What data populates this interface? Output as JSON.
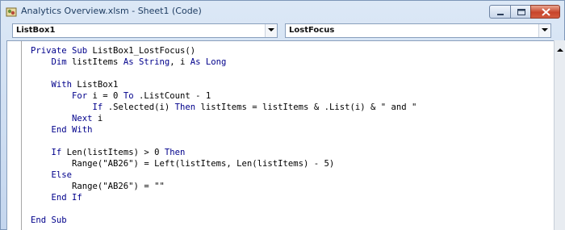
{
  "window": {
    "title": "Analytics Overview.xlsm - Sheet1 (Code)"
  },
  "toolbar": {
    "object_dropdown": {
      "selected": "ListBox1"
    },
    "procedure_dropdown": {
      "selected": "LostFocus"
    }
  },
  "code": {
    "lines": [
      [
        {
          "t": "Private Sub ",
          "k": true
        },
        {
          "t": "ListBox1_LostFocus()"
        }
      ],
      [
        {
          "t": "    "
        },
        {
          "t": "Dim ",
          "k": true
        },
        {
          "t": "listItems "
        },
        {
          "t": "As String",
          "k": true
        },
        {
          "t": ", i "
        },
        {
          "t": "As Long",
          "k": true
        }
      ],
      [
        {
          "t": ""
        }
      ],
      [
        {
          "t": "    "
        },
        {
          "t": "With ",
          "k": true
        },
        {
          "t": "ListBox1"
        }
      ],
      [
        {
          "t": "        "
        },
        {
          "t": "For ",
          "k": true
        },
        {
          "t": "i = 0 "
        },
        {
          "t": "To ",
          "k": true
        },
        {
          "t": ".ListCount - 1"
        }
      ],
      [
        {
          "t": "            "
        },
        {
          "t": "If ",
          "k": true
        },
        {
          "t": ".Selected(i) "
        },
        {
          "t": "Then ",
          "k": true
        },
        {
          "t": "listItems = listItems & .List(i) & \" and \""
        }
      ],
      [
        {
          "t": "        "
        },
        {
          "t": "Next ",
          "k": true
        },
        {
          "t": "i"
        }
      ],
      [
        {
          "t": "    "
        },
        {
          "t": "End With",
          "k": true
        }
      ],
      [
        {
          "t": ""
        }
      ],
      [
        {
          "t": "    "
        },
        {
          "t": "If ",
          "k": true
        },
        {
          "t": "Len(listItems) > 0 "
        },
        {
          "t": "Then",
          "k": true
        }
      ],
      [
        {
          "t": "        Range(\"AB26\") = Left(listItems, Len(listItems) - 5)"
        }
      ],
      [
        {
          "t": "    "
        },
        {
          "t": "Else",
          "k": true
        }
      ],
      [
        {
          "t": "        Range(\"AB26\") = \"\""
        }
      ],
      [
        {
          "t": "    "
        },
        {
          "t": "End If",
          "k": true
        }
      ],
      [
        {
          "t": ""
        }
      ],
      [
        {
          "t": "End Sub",
          "k": true
        }
      ]
    ]
  },
  "colors": {
    "keyword": "#00008b",
    "identifier": "#000000",
    "editor_background": "#ffffff",
    "chrome": "#c9d9ee",
    "close_button": "#c8452c"
  },
  "icons": {
    "title": "vba-project-icon",
    "minimize": "minimize-icon",
    "maximize": "maximize-icon",
    "close": "close-icon",
    "dropdown": "chevron-down-icon",
    "scroll_up": "scroll-up-arrow-icon"
  }
}
